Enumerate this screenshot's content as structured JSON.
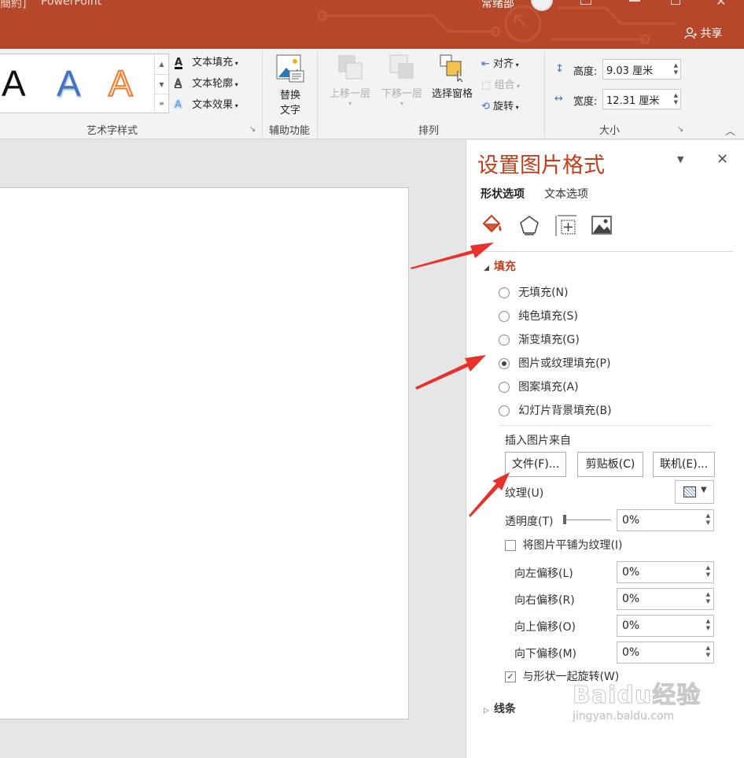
{
  "titlebar": {
    "doc_fragment": "簡約]",
    "app_name": "PowerPoint",
    "user": "常绪部",
    "share": "共享",
    "color": "#b7472a"
  },
  "ribbon": {
    "wordart_group": {
      "label": "艺术字样式",
      "samples": [
        "A",
        "A",
        "A"
      ],
      "text_fill": "文本填充",
      "text_outline": "文本轮廓",
      "text_effect": "文本效果"
    },
    "accessibility_group": {
      "label": "辅助功能",
      "alt_text_line1": "替换",
      "alt_text_line2": "文字"
    },
    "arrange_group": {
      "label": "排列",
      "bring_forward": "上移一层",
      "send_backward": "下移一层",
      "selection_pane": "选择窗格",
      "align": "对齐",
      "group": "组合",
      "rotate": "旋转"
    },
    "size_group": {
      "label": "大小",
      "height_label": "高度:",
      "height_value": "9.03 厘米",
      "width_label": "宽度:",
      "width_value": "12.31 厘米"
    }
  },
  "pane": {
    "title": "设置图片格式",
    "tabs": [
      "形状选项",
      "文本选项"
    ],
    "fill_section": "填充",
    "fill_options": [
      {
        "label": "无填充(N)",
        "selected": false
      },
      {
        "label": "纯色填充(S)",
        "selected": false
      },
      {
        "label": "渐变填充(G)",
        "selected": false
      },
      {
        "label": "图片或纹理填充(P)",
        "selected": true
      },
      {
        "label": "图案填充(A)",
        "selected": false
      },
      {
        "label": "幻灯片背景填充(B)",
        "selected": false
      }
    ],
    "insert_from": "插入图片来自",
    "insert_buttons": [
      "文件(F)...",
      "剪贴板(C)",
      "联机(E)..."
    ],
    "texture_label": "纹理(U)",
    "transparency_label": "透明度(T)",
    "transparency_value": "0%",
    "tile_label": "将图片平铺为纹理(I)",
    "offsets": [
      {
        "label": "向左偏移(L)",
        "value": "0%"
      },
      {
        "label": "向右偏移(R)",
        "value": "0%"
      },
      {
        "label": "向上偏移(O)",
        "value": "0%"
      },
      {
        "label": "向下偏移(M)",
        "value": "0%"
      }
    ],
    "rotate_with_shape": "与形状一起旋转(W)",
    "line_section": "线条",
    "accent": "#c43e1c"
  },
  "watermark": {
    "brand": "Baidu经验",
    "url": "jingyan.baidu.com"
  }
}
